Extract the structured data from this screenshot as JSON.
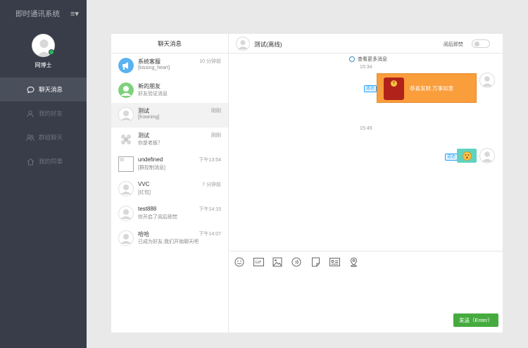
{
  "app": {
    "title": "即时通讯系统",
    "menu_icon": "hamburger-icon"
  },
  "user": {
    "name": "网博士",
    "status_color": "#1fbc5d"
  },
  "nav": [
    {
      "label": "聊天消息",
      "icon": "chat-bubble-icon",
      "active": true
    },
    {
      "label": "我的好友",
      "icon": "user-icon",
      "active": false
    },
    {
      "label": "群组聊天",
      "icon": "group-icon",
      "active": false
    },
    {
      "label": "我的同事",
      "icon": "home-icon",
      "active": false
    }
  ],
  "list": {
    "header": "聊天消息",
    "conversations": [
      {
        "title": "系统客服",
        "time": "10 分钟前",
        "preview": "[kissing_heart]",
        "avatar": "megaphone-icon"
      },
      {
        "title": "新的朋友",
        "time": "",
        "preview": "好友验证消息",
        "avatar": "user-icon"
      },
      {
        "title": "测试",
        "time": "刚刚",
        "preview": "[frowning]",
        "avatar": "user-icon"
      },
      {
        "title": "测试",
        "time": "刚刚",
        "preview": "你是老板？",
        "avatar": "group-icon"
      },
      {
        "title": "undefined",
        "time": "下午13:54",
        "preview": "[群控制消息]",
        "avatar": "broken-image-icon"
      },
      {
        "title": "VVC",
        "time": "7 分钟前",
        "preview": "[红包]",
        "avatar": "user-icon"
      },
      {
        "title": "test888",
        "time": "下午14:15",
        "preview": "你开启了阅后即焚",
        "avatar": "user-icon"
      },
      {
        "title": "哈哈",
        "time": "下午14:07",
        "preview": "已成为好友,我们开始聊天吧",
        "avatar": "user-icon"
      }
    ]
  },
  "chat": {
    "title": "测试(离线)",
    "burn_after_reading_label": "阅后即焚",
    "burn_after_reading_on": false,
    "load_more": "查看更多消息",
    "messages": [
      {
        "time": "15:34",
        "status": "送达",
        "type": "red-packet",
        "text": "恭喜发财,万事如意"
      },
      {
        "time": "15:49",
        "status": "送达",
        "type": "emoji",
        "text": "frowning"
      }
    ],
    "toolbar": [
      "smile-icon",
      "gif-icon",
      "image-icon",
      "voice-icon",
      "file-icon",
      "card-icon",
      "location-icon"
    ],
    "send_label": "发送（Enter）"
  },
  "colors": {
    "sidebar": "#393d49",
    "send": "#45ab3f",
    "red_packet": "#fa9d3b",
    "badge": "#1e9fff"
  }
}
